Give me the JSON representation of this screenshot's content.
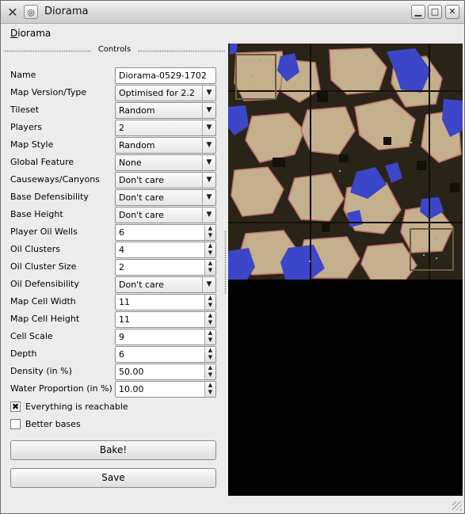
{
  "window": {
    "title": "Diorama",
    "app_icon": "x-logo-icon",
    "buttons": [
      "minimize-icon",
      "maximize-icon",
      "close-icon"
    ]
  },
  "menubar": {
    "menu_underlined_letter": "D",
    "menu_rest": "iorama"
  },
  "controls": {
    "header": "Controls",
    "name": {
      "label": "Name",
      "value": "Diorama-0529-1702"
    },
    "map_version": {
      "label": "Map Version/Type",
      "value": "Optimised for 2.2"
    },
    "tileset": {
      "label": "Tileset",
      "value": "Random"
    },
    "players": {
      "label": "Players",
      "value": "2"
    },
    "map_style": {
      "label": "Map Style",
      "value": "Random"
    },
    "global_feature": {
      "label": "Global Feature",
      "value": "None"
    },
    "causeways": {
      "label": "Causeways/Canyons",
      "value": "Don't care"
    },
    "base_defensibility": {
      "label": "Base Defensibility",
      "value": "Don't care"
    },
    "base_height": {
      "label": "Base Height",
      "value": "Don't care"
    },
    "player_oil_wells": {
      "label": "Player Oil Wells",
      "value": "6"
    },
    "oil_clusters": {
      "label": "Oil Clusters",
      "value": "4"
    },
    "oil_cluster_size": {
      "label": "Oil Cluster Size",
      "value": "2"
    },
    "oil_defensibility": {
      "label": "Oil Defensibility",
      "value": "Don't care"
    },
    "map_cell_width": {
      "label": "Map Cell Width",
      "value": "11"
    },
    "map_cell_height": {
      "label": "Map Cell Height",
      "value": "11"
    },
    "cell_scale": {
      "label": "Cell Scale",
      "value": "9"
    },
    "depth": {
      "label": "Depth",
      "value": "6"
    },
    "density": {
      "label": "Density (in %)",
      "value": "50.00"
    },
    "water_proportion": {
      "label": "Water Proportion (in %)",
      "value": "10.00"
    },
    "everything_reachable": {
      "label": "Everything is reachable",
      "checked": true
    },
    "better_bases": {
      "label": "Better bases",
      "checked": false
    },
    "bake_label": "Bake!",
    "save_label": "Save"
  },
  "colors": {
    "water": "#3c46c8",
    "terrain_light": "#c4b08c",
    "terrain_dark": "#2a2418",
    "cliff_outline": "#c07070",
    "oil": "#60d060"
  }
}
